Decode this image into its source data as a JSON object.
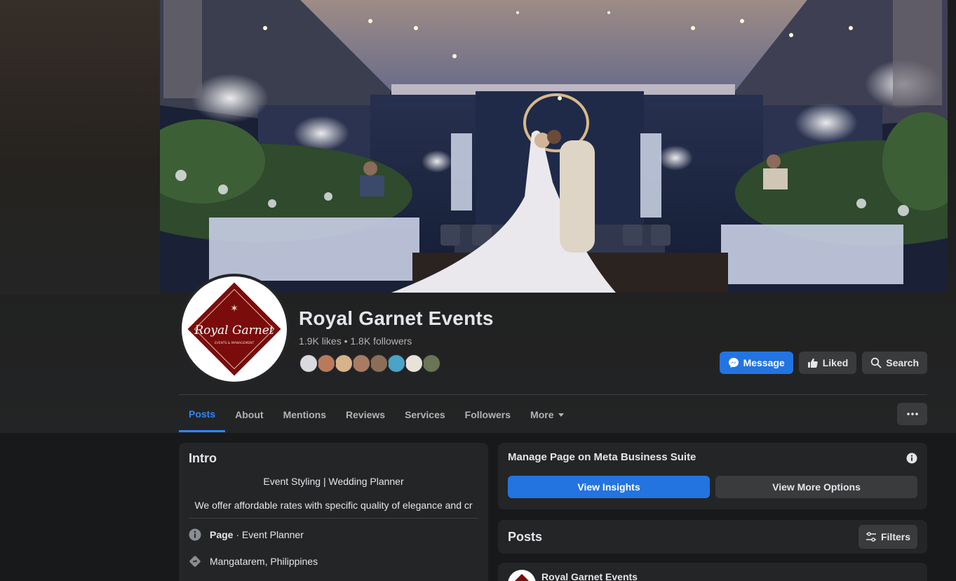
{
  "page": {
    "name": "Royal Garnet Events",
    "stats": "1.9K likes • 1.8K followers",
    "logo_text": "Royal Garnet",
    "logo_subtext": "EVENTS & MANAGEMENT"
  },
  "actions": {
    "message": "Message",
    "liked": "Liked",
    "search": "Search"
  },
  "tabs": [
    {
      "label": "Posts",
      "active": true
    },
    {
      "label": "About"
    },
    {
      "label": "Mentions"
    },
    {
      "label": "Reviews"
    },
    {
      "label": "Services"
    },
    {
      "label": "Followers"
    },
    {
      "label": "More"
    }
  ],
  "intro": {
    "title": "Intro",
    "tagline": "Event Styling | Wedding Planner",
    "bio": "We offer affordable rates with specific quality of elegance and cr",
    "category_bold": "Page",
    "category": " · Event Planner",
    "location": "Mangatarem, Philippines"
  },
  "manage": {
    "title": "Manage Page on Meta Business Suite",
    "insights": "View Insights",
    "more_options": "View More Options"
  },
  "posts": {
    "title": "Posts",
    "filters": "Filters",
    "first_author": "Royal Garnet Events"
  },
  "colors": {
    "accent": "#2374e1",
    "tab_active": "#2d88ff",
    "garnet": "#7a0c0c"
  },
  "friend_colors": [
    "#d8dadf",
    "#b97a5c",
    "#d6b38a",
    "#a87b63",
    "#8c6e57",
    "#4ba3c7",
    "#e9e2d8",
    "#6b7455"
  ]
}
